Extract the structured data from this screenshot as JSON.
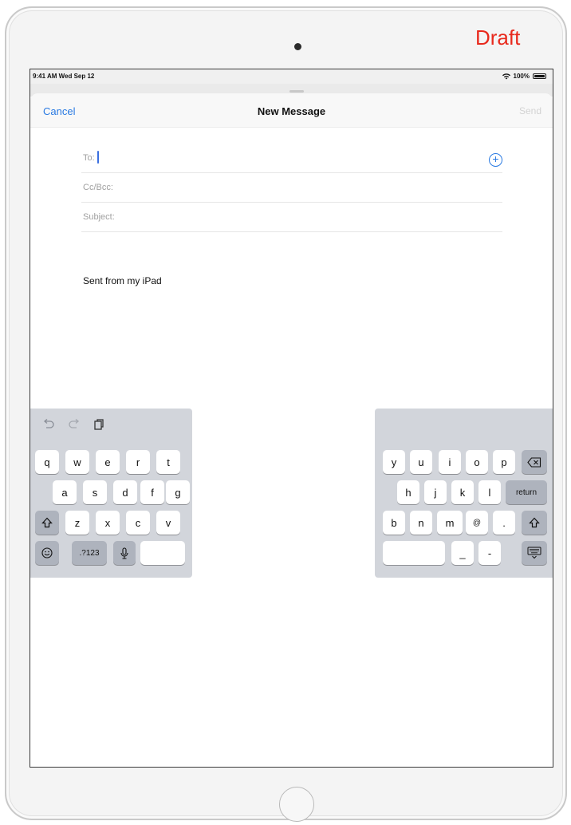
{
  "draft_label": "Draft",
  "status_bar": {
    "time_date": "9:41 AM  Wed Sep 12",
    "battery": "100%"
  },
  "nav": {
    "cancel": "Cancel",
    "title": "New Message",
    "send": "Send"
  },
  "fields": {
    "to": "To:",
    "cc_bcc": "Cc/Bcc:",
    "subject": "Subject:"
  },
  "body": "Sent from my iPad",
  "icons": {
    "undo": "undo-icon",
    "redo": "redo-icon",
    "paste": "paste-icon",
    "add_contact": "plus-circle-icon",
    "shift": "shift-icon",
    "delete": "delete-icon",
    "emoji": "emoji-icon",
    "dictation": "microphone-icon",
    "hide_keyboard": "keyboard-dismiss-icon"
  },
  "colors": {
    "accent": "#2a7ae2",
    "draft": "#e8291c",
    "keyboard_bg": "#d2d5db",
    "function_key": "#aeb3bd"
  },
  "keyboard": {
    "left": {
      "row1": [
        "q",
        "w",
        "e",
        "r",
        "t"
      ],
      "row2": [
        "a",
        "s",
        "d",
        "f",
        "g"
      ],
      "row3": [
        "z",
        "x",
        "c",
        "v"
      ],
      "numbers_key": ".?123"
    },
    "right": {
      "row1": [
        "y",
        "u",
        "i",
        "o",
        "p"
      ],
      "row2": [
        "h",
        "j",
        "k",
        "l"
      ],
      "return_key": "return",
      "row3": [
        "b",
        "n",
        "m",
        "@",
        "."
      ],
      "row4": [
        "_",
        "-"
      ]
    }
  }
}
